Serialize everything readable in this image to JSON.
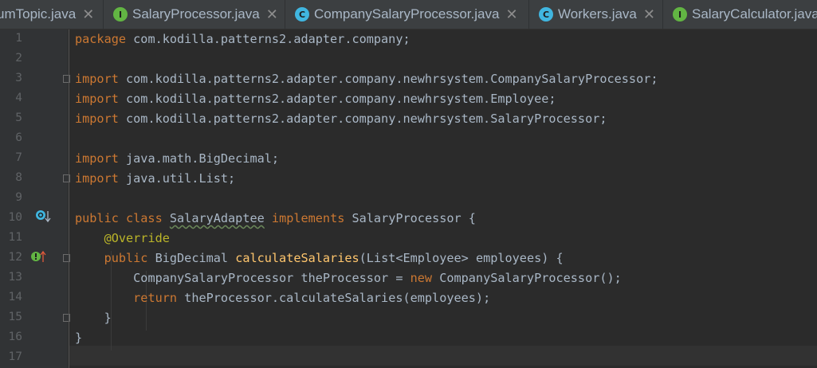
{
  "tabs": [
    {
      "label": "umTopic.java",
      "kind": "none"
    },
    {
      "label": "SalaryProcessor.java",
      "kind": "interface",
      "badge": "I"
    },
    {
      "label": "CompanySalaryProcessor.java",
      "kind": "class",
      "badge": "C"
    },
    {
      "label": "Workers.java",
      "kind": "class",
      "badge": "C"
    },
    {
      "label": "SalaryCalculator.java",
      "kind": "interface",
      "badge": "I"
    }
  ],
  "close_glyph": "✕",
  "line_numbers": [
    "1",
    "2",
    "3",
    "4",
    "5",
    "6",
    "7",
    "8",
    "9",
    "10",
    "11",
    "12",
    "13",
    "14",
    "15",
    "16",
    "17"
  ],
  "code": {
    "l1_kw": "package",
    "l1_rest": " com.kodilla.patterns2.adapter.company;",
    "l3_kw": "import",
    "l3_rest": " com.kodilla.patterns2.adapter.company.newhrsystem.CompanySalaryProcessor;",
    "l4_kw": "import",
    "l4_rest": " com.kodilla.patterns2.adapter.company.newhrsystem.Employee;",
    "l5_kw": "import",
    "l5_rest": " com.kodilla.patterns2.adapter.company.newhrsystem.SalaryProcessor;",
    "l7_kw": "import",
    "l7_rest": " java.math.BigDecimal;",
    "l8_kw": "import",
    "l8_rest": " java.util.List;",
    "l10_kw1": "public class",
    "l10_name": "SalaryAdaptee",
    "l10_kw2": "implements",
    "l10_rest": " SalaryProcessor {",
    "l11_an": "@Override",
    "l12_kw": "public",
    "l12_type": " BigDecimal ",
    "l12_fn": "calculateSalaries",
    "l12_rest": "(List<Employee> employees) {",
    "l13_a": "CompanySalaryProcessor theProcessor = ",
    "l13_kw": "new",
    "l13_b": " CompanySalaryProcessor();",
    "l14_kw": "return",
    "l14_rest": " theProcessor.calculateSalaries(employees);",
    "l15": "}",
    "l16": "}"
  },
  "gutter_icons": {
    "line10": "implements-interface-icon",
    "line12": "overrides-method-icon"
  },
  "colors": {
    "background": "#2b2b2b",
    "keyword": "#cc7832",
    "annotation": "#bbb529",
    "method": "#ffc66d",
    "text": "#a9b7c6"
  }
}
